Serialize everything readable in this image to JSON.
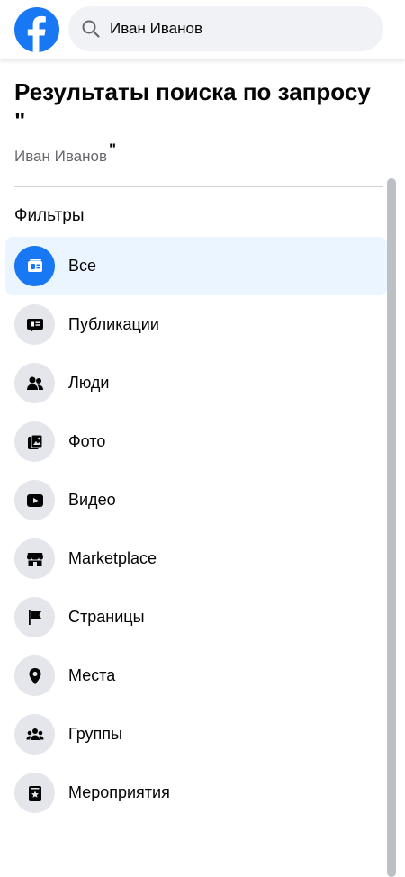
{
  "search": {
    "value": "Иван Иванов"
  },
  "results": {
    "title": "Результаты поиска по запросу \"",
    "query": "Иван Иванов",
    "quote_close": "\""
  },
  "filters": {
    "label": "Фильтры",
    "items": [
      {
        "label": "Все",
        "icon": "results-all-icon",
        "active": true
      },
      {
        "label": "Публикации",
        "icon": "posts-icon"
      },
      {
        "label": "Люди",
        "icon": "people-icon"
      },
      {
        "label": "Фото",
        "icon": "photos-icon"
      },
      {
        "label": "Видео",
        "icon": "video-icon"
      },
      {
        "label": "Marketplace",
        "icon": "marketplace-icon"
      },
      {
        "label": "Страницы",
        "icon": "pages-icon"
      },
      {
        "label": "Места",
        "icon": "places-icon"
      },
      {
        "label": "Группы",
        "icon": "groups-icon"
      },
      {
        "label": "Мероприятия",
        "icon": "events-icon"
      }
    ]
  },
  "colors": {
    "brand": "#1877f2",
    "active_bg": "#ebf5ff",
    "icon_bg": "#e4e6eb"
  }
}
